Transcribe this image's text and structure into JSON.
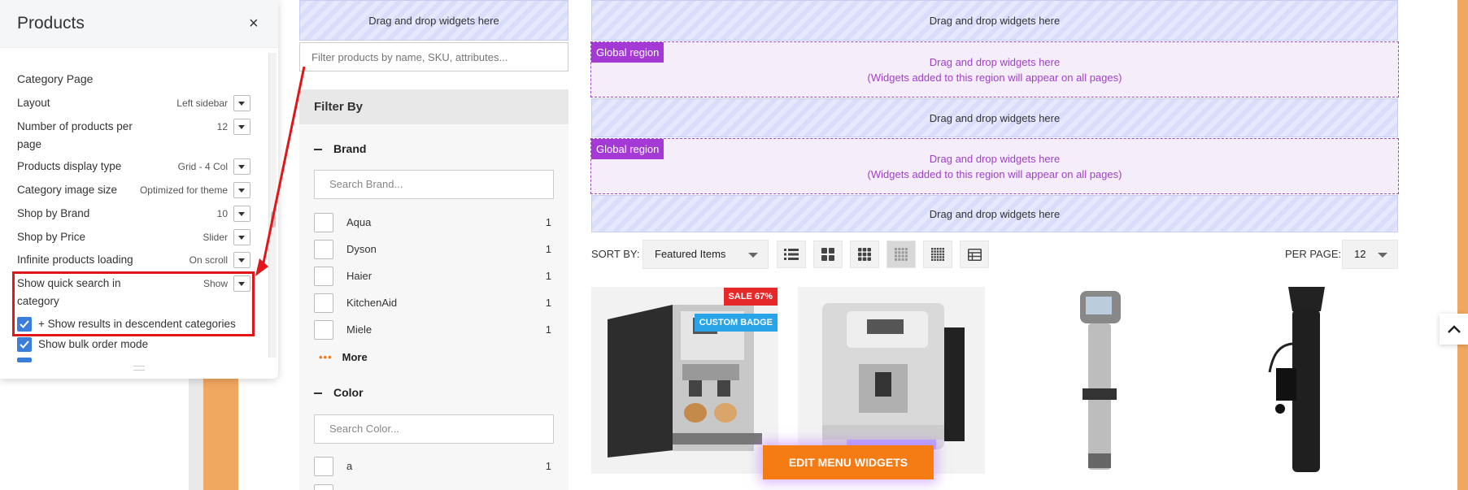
{
  "panel": {
    "title": "Products",
    "close_label": "×",
    "section_title": "Category Page",
    "settings": [
      {
        "label": "Layout",
        "value": "Left sidebar"
      },
      {
        "label": "Number of products per page",
        "value": "12"
      },
      {
        "label": "Products display type",
        "value": "Grid - 4 Col"
      },
      {
        "label": "Category image size",
        "value": "Optimized for theme"
      },
      {
        "label": "Shop by Brand",
        "value": "10"
      },
      {
        "label": "Shop by Price",
        "value": "Slider"
      },
      {
        "label": "Infinite products loading",
        "value": "On scroll"
      },
      {
        "label": "Show quick search in category",
        "value": "Show"
      }
    ],
    "checks": [
      {
        "label": "+ Show results in descendent categories",
        "checked": true
      },
      {
        "label": "Show bulk order mode",
        "checked": true
      }
    ]
  },
  "dropzones": {
    "label": "Drag and drop widgets here",
    "global_tag": "Global region",
    "global_line1": "Drag and drop widgets here",
    "global_line2": "(Widgets added to this region will appear on all pages)"
  },
  "filter": {
    "search_placeholder": "Filter products by name, SKU, attributes...",
    "heading": "Filter By",
    "brand_title": "Brand",
    "brand_search": "Search Brand...",
    "brands": [
      {
        "name": "Aqua",
        "count": "1"
      },
      {
        "name": "Dyson",
        "count": "1"
      },
      {
        "name": "Haier",
        "count": "1"
      },
      {
        "name": "KitchenAid",
        "count": "1"
      },
      {
        "name": "Miele",
        "count": "1"
      }
    ],
    "more_dots": "•••",
    "more_label": "More",
    "color_title": "Color",
    "color_search": "Search Color...",
    "colors": [
      {
        "name": "a",
        "count": "1"
      }
    ]
  },
  "toolbar": {
    "sort_label": "SORT BY:",
    "sort_value": "Featured Items",
    "per_page_label": "PER PAGE:",
    "per_page_value": "12",
    "view_icons": [
      "list-icon",
      "grid-2-icon",
      "grid-3-icon",
      "grid-4-icon",
      "grid-5-icon",
      "table-icon"
    ],
    "active_view": 3
  },
  "products": {
    "sale_badge": "SALE  67%",
    "custom_badge": "CUSTOM BADGE",
    "edit_menu": "EDIT MENU WIDGETS"
  },
  "colors": {
    "accent_orange": "#f57c14",
    "global_region": "#a439d6",
    "highlight_red": "#e0161a",
    "checkbox_blue": "#3b7ddd"
  }
}
